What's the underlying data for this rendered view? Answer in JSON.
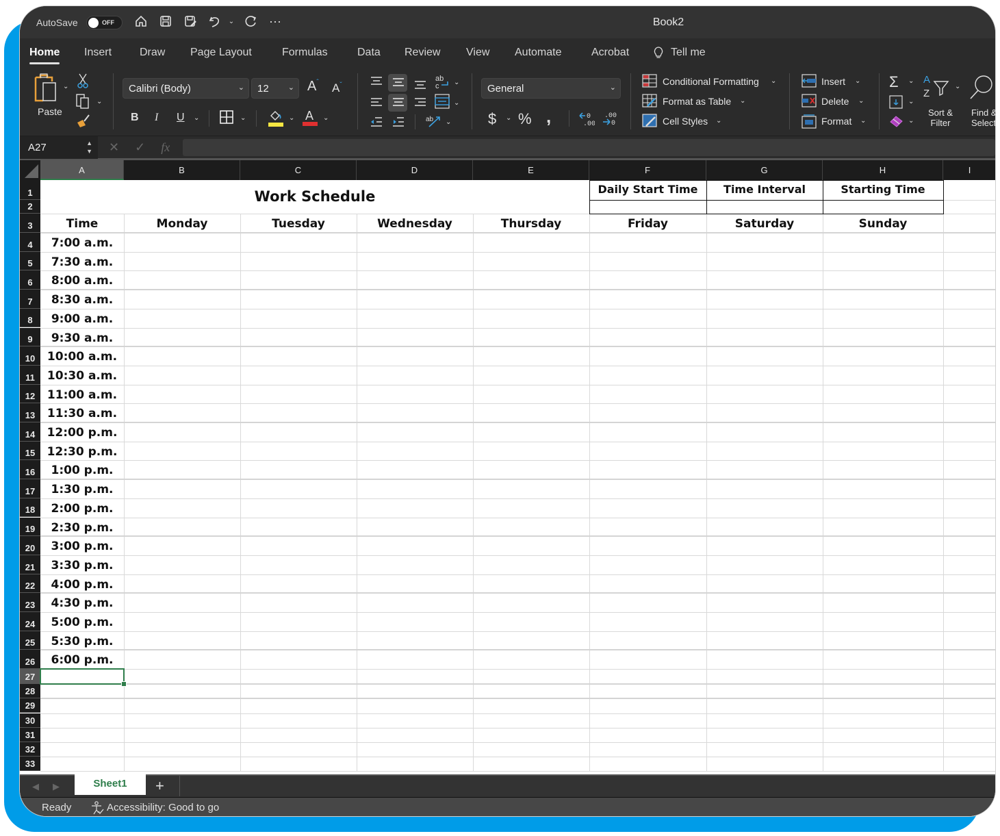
{
  "titlebar": {
    "autosave_label": "AutoSave",
    "autosave_state": "OFF",
    "document_title": "Book2",
    "icons": [
      "home-icon",
      "save-icon",
      "save-as-icon",
      "undo-icon",
      "redo-icon",
      "more-icon"
    ]
  },
  "tabs": [
    {
      "label": "Home",
      "active": true
    },
    {
      "label": "Insert"
    },
    {
      "label": "Draw"
    },
    {
      "label": "Page Layout"
    },
    {
      "label": "Formulas"
    },
    {
      "label": "Data"
    },
    {
      "label": "Review"
    },
    {
      "label": "View"
    },
    {
      "label": "Automate"
    },
    {
      "label": "Acrobat"
    },
    {
      "label": "Tell me"
    }
  ],
  "ribbon": {
    "paste_label": "Paste",
    "font_name": "Calibri (Body)",
    "font_size": "12",
    "bold": "B",
    "italic": "I",
    "underline": "U",
    "number_format": "General",
    "currency": "$",
    "percent": "%",
    "comma": ",",
    "conditional_formatting": "Conditional Formatting",
    "format_as_table": "Format as Table",
    "cell_styles": "Cell Styles",
    "insert": "Insert",
    "delete": "Delete",
    "format": "Format",
    "sort_filter_line1": "Sort &",
    "sort_filter_line2": "Filter",
    "find_select_line1": "Find &",
    "find_select_line2": "Select",
    "highlight_color": "#f5e642",
    "font_color": "#e03030"
  },
  "formula_bar": {
    "name_box": "A27",
    "fx": "fx",
    "formula": ""
  },
  "grid": {
    "columns": [
      "A",
      "B",
      "C",
      "D",
      "E",
      "F",
      "G",
      "H",
      "I"
    ],
    "selected_column": "A",
    "selected_row": "27",
    "rows": [
      "1",
      "2",
      "3",
      "4",
      "5",
      "6",
      "7",
      "8",
      "9",
      "10",
      "11",
      "12",
      "13",
      "14",
      "15",
      "16",
      "17",
      "18",
      "19",
      "20",
      "21",
      "22",
      "23",
      "24",
      "25",
      "26",
      "27",
      "28",
      "29",
      "30",
      "31",
      "32",
      "33"
    ],
    "title": "Work Schedule",
    "info_headers": [
      "Daily Start Time",
      "Time Interval",
      "Starting Time"
    ],
    "info_values": [
      "",
      "",
      ""
    ],
    "day_headers": [
      "Time",
      "Monday",
      "Tuesday",
      "Wednesday",
      "Thursday",
      "Friday",
      "Saturday",
      "Sunday"
    ],
    "times": [
      "7:00 a.m.",
      "7:30 a.m.",
      "8:00 a.m.",
      "8:30 a.m.",
      "9:00 a.m.",
      "9:30 a.m.",
      "10:00 a.m.",
      "10:30 a.m.",
      "11:00 a.m.",
      "11:30 a.m.",
      "12:00 p.m.",
      "12:30 p.m.",
      "1:00 p.m.",
      "1:30 p.m.",
      "2:00 p.m.",
      "2:30 p.m.",
      "3:00 p.m.",
      "3:30 p.m.",
      "4:00 p.m.",
      "4:30 p.m.",
      "5:00 p.m.",
      "5:30 p.m.",
      "6:00 p.m."
    ]
  },
  "sheets": {
    "tabs": [
      "Sheet1"
    ],
    "active": "Sheet1",
    "add_label": "+"
  },
  "status": {
    "ready": "Ready",
    "accessibility": "Accessibility: Good to go"
  },
  "colors": {
    "accent_green": "#2e7d4a",
    "frame_blue": "#009ce8"
  }
}
